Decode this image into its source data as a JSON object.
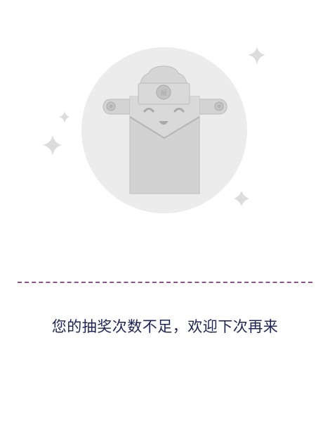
{
  "result": {
    "message": "您的抽奖次数不足，欢迎下次再来",
    "illustration_icon": "empty-red-envelope-mascot-icon"
  },
  "colors": {
    "divider": "#8c4f8a",
    "message_text": "#1e2555",
    "illustration_gray": "#cfcfcf"
  }
}
